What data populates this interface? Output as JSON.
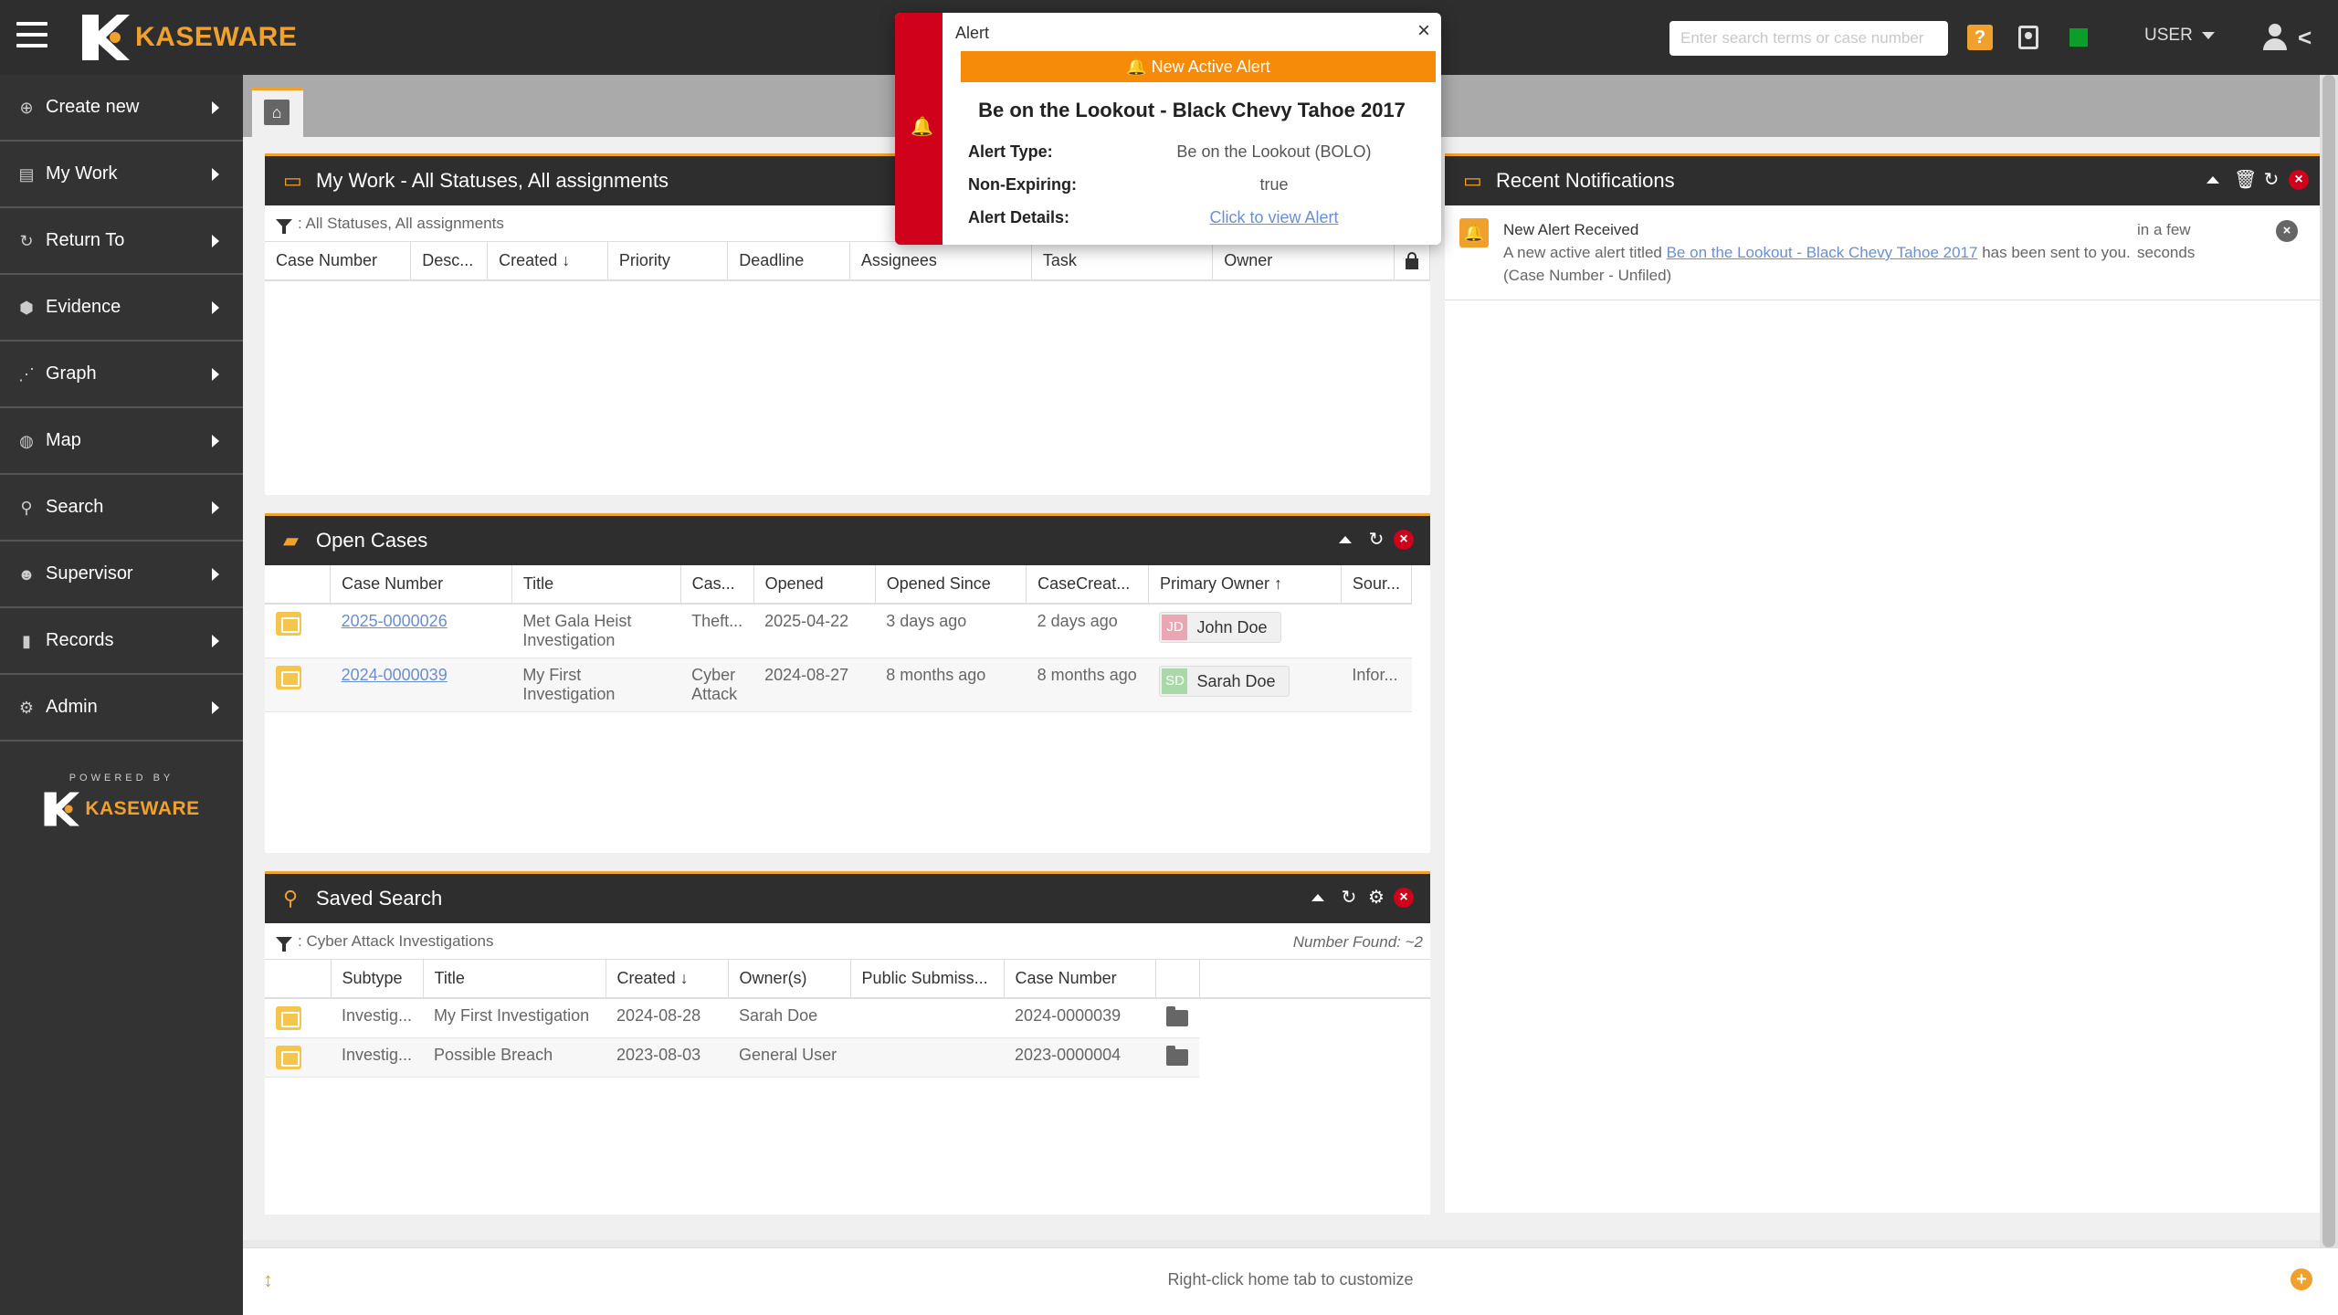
{
  "app": {
    "brand": "KASEWARE",
    "search_placeholder": "Enter search terms or case number",
    "help_label": "?",
    "user_label": "USER",
    "collapse_label": "<"
  },
  "sidebar": {
    "items": [
      {
        "label": "Create new",
        "icon": "plus-circle-icon"
      },
      {
        "label": "My Work",
        "icon": "inbox-icon"
      },
      {
        "label": "Return To",
        "icon": "redo-icon"
      },
      {
        "label": "Evidence",
        "icon": "cubes-icon"
      },
      {
        "label": "Graph",
        "icon": "graph-icon"
      },
      {
        "label": "Map",
        "icon": "globe-icon"
      },
      {
        "label": "Search",
        "icon": "search-icon"
      },
      {
        "label": "Supervisor",
        "icon": "users-icon"
      },
      {
        "label": "Records",
        "icon": "file-icon"
      },
      {
        "label": "Admin",
        "icon": "gears-icon"
      }
    ],
    "powered_by": "POWERED BY",
    "powered_brand": "KASEWARE"
  },
  "my_work": {
    "title": "My Work - All Statuses, All assignments",
    "filter": ": All Statuses, All assignments",
    "columns": [
      "Case Number",
      "Desc...",
      "Created",
      "Priority",
      "Deadline",
      "Assignees",
      "Task",
      "Owner"
    ]
  },
  "open_cases": {
    "title": "Open Cases",
    "columns": [
      "Case Number",
      "Title",
      "Cas...",
      "Opened",
      "Opened Since",
      "CaseCreat...",
      "Primary Owner",
      "Sour..."
    ],
    "rows": [
      {
        "case_number": "2025-0000026",
        "title": "Met Gala Heist Investigation",
        "type": "Theft...",
        "opened": "2025-04-22",
        "opened_since": "3 days ago",
        "created": "2 days ago",
        "owner_initials": "JD",
        "owner": "John Doe",
        "source": ""
      },
      {
        "case_number": "2024-0000039",
        "title": "My First Investigation",
        "type": "Cyber Attack",
        "opened": "2024-08-27",
        "opened_since": "8 months ago",
        "created": "8 months ago",
        "owner_initials": "SD",
        "owner": "Sarah Doe",
        "source": "Infor..."
      }
    ]
  },
  "saved_search": {
    "title": "Saved Search",
    "filter": ": Cyber Attack Investigations",
    "number_found": "Number Found: ~2",
    "columns": [
      "Subtype",
      "Title",
      "Created",
      "Owner(s)",
      "Public Submiss...",
      "Case Number"
    ],
    "rows": [
      {
        "subtype": "Investig...",
        "title": "My First Investigation",
        "created": "2024-08-28",
        "owner": "Sarah Doe",
        "public": "",
        "case_number": "2024-0000039"
      },
      {
        "subtype": "Investig...",
        "title": "Possible Breach",
        "created": "2023-08-03",
        "owner": "General User",
        "public": "",
        "case_number": "2023-0000004"
      }
    ]
  },
  "notifications": {
    "title": "Recent Notifications",
    "items": [
      {
        "title": "New Alert Received",
        "text_before": "A new active alert titled ",
        "link": "Be on the Lookout - Black Chevy Tahoe 2017",
        "text_after": " has been sent to you. (Case Number - Unfiled)",
        "time": "in a few seconds"
      }
    ]
  },
  "alert": {
    "title": "Alert",
    "banner": "New Active Alert",
    "heading": "Be on the Lookout - Black Chevy Tahoe 2017",
    "type_label": "Alert Type:",
    "type_value": "Be on the Lookout (BOLO)",
    "nonexp_label": "Non-Expiring:",
    "nonexp_value": "true",
    "details_label": "Alert Details:",
    "details_value": "Click to view Alert"
  },
  "footer": {
    "hint": "Right-click home tab to customize"
  },
  "colors": {
    "accent": "#f0a02d",
    "alert_red": "#d0021b",
    "status_green": "#0b9e2b"
  }
}
